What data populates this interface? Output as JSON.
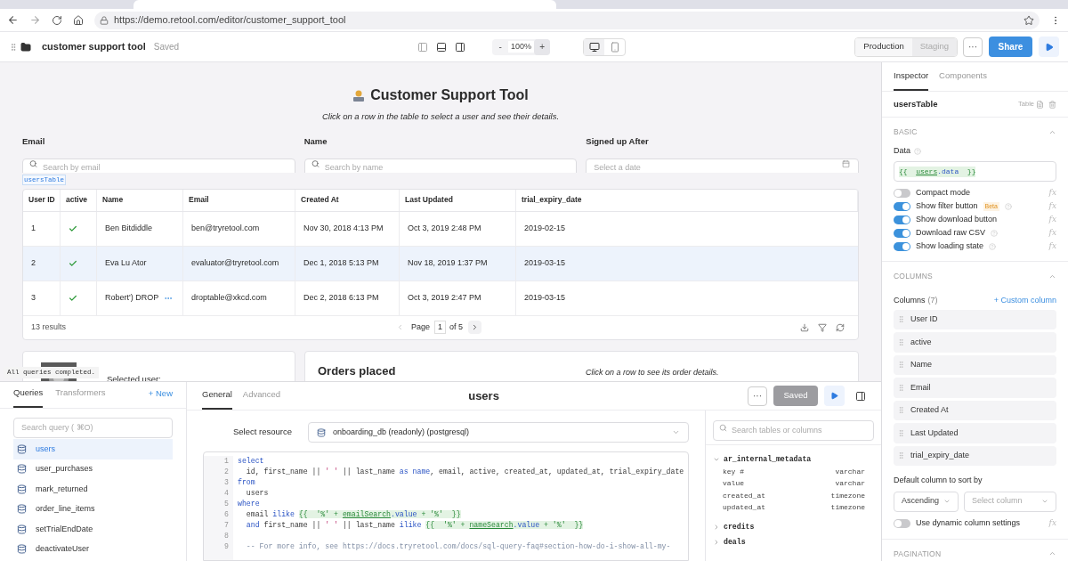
{
  "browser": {
    "url": "https://demo.retool.com/editor/customer_support_tool"
  },
  "app_header": {
    "title": "customer support tool",
    "status": "Saved",
    "zoom_out": "-",
    "zoom": "100%",
    "zoom_in": "+",
    "environments": [
      {
        "label": "Production",
        "selected": true
      },
      {
        "label": "Staging",
        "selected": false
      }
    ],
    "more": "···",
    "share": "Share"
  },
  "canvas": {
    "title": "Customer Support Tool",
    "subtitle": "Click on a row in the table to select a user and see their details.",
    "filters": [
      {
        "label": "Email",
        "placeholder": "Search by email",
        "kind": "search"
      },
      {
        "label": "Name",
        "placeholder": "Search by name",
        "kind": "search"
      },
      {
        "label": "Signed up After",
        "placeholder": "Select a date",
        "kind": "date"
      }
    ],
    "table_tag": "usersTable",
    "table": {
      "columns": [
        "User ID",
        "active",
        "Name",
        "Email",
        "Created At",
        "Last Updated",
        "trial_expiry_date"
      ],
      "rows": [
        {
          "user_id": "1",
          "active": true,
          "name": "Ben Bitdiddle",
          "name_overflow": false,
          "email": "ben@tryretool.com",
          "created_at": "Nov 30, 2018 4:13 PM",
          "last_updated": "Oct 3, 2019 2:48 PM",
          "trial_expiry_date": "2019-02-15",
          "selected": false
        },
        {
          "user_id": "2",
          "active": true,
          "name": "Eva Lu Ator",
          "name_overflow": false,
          "email": "evaluator@tryretool.com",
          "created_at": "Dec 1, 2018 5:13 PM",
          "last_updated": "Nov 18, 2019 1:37 PM",
          "trial_expiry_date": "2019-03-15",
          "selected": true
        },
        {
          "user_id": "3",
          "active": true,
          "name": "Robert') DROP",
          "name_overflow": true,
          "email": "droptable@xkcd.com",
          "created_at": "Dec 2, 2018 6:13 PM",
          "last_updated": "Oct 3, 2019 2:47 PM",
          "trial_expiry_date": "2019-03-15",
          "selected": false
        }
      ],
      "results": "13 results",
      "page_label": "Page",
      "page": "1",
      "page_of": "of 5"
    },
    "selected_user_card": {
      "label": "Selected user:"
    },
    "orders_card": {
      "title": "Orders placed",
      "hint": "Click on a row to see its order details."
    },
    "toast": "All queries completed."
  },
  "query_panel": {
    "tabs": [
      {
        "label": "Queries",
        "selected": true
      },
      {
        "label": "Transformers",
        "selected": false
      }
    ],
    "new": "+ New",
    "search_placeholder": "Search query ( ⌘O)",
    "queries": [
      {
        "name": "users",
        "selected": true
      },
      {
        "name": "user_purchases",
        "selected": false
      },
      {
        "name": "mark_returned",
        "selected": false
      },
      {
        "name": "order_line_items",
        "selected": false
      },
      {
        "name": "setTrialEndDate",
        "selected": false
      },
      {
        "name": "deactivateUser",
        "selected": false
      }
    ],
    "editor_tabs": [
      {
        "label": "General",
        "selected": true
      },
      {
        "label": "Advanced",
        "selected": false
      }
    ],
    "title": "users",
    "more": "···",
    "save": {
      "label": "Saved",
      "disabled": true
    },
    "resource_label": "Select resource",
    "resource": "onboarding_db (readonly) (postgresql)",
    "code": [
      {
        "number": "1",
        "segments": [
          {
            "kind": "keyword",
            "text": "select"
          }
        ]
      },
      {
        "number": "2",
        "segments": [
          {
            "kind": "plain",
            "text": "  id, first_name || "
          },
          {
            "kind": "string",
            "text": "' '"
          },
          {
            "kind": "plain",
            "text": " || last_name "
          },
          {
            "kind": "keyword",
            "text": "as "
          },
          {
            "kind": "keyword",
            "text": "name"
          },
          {
            "kind": "plain",
            "text": ", email, active, created_at, updated_at, trial_expiry_date"
          }
        ]
      },
      {
        "number": "3",
        "segments": [
          {
            "kind": "keyword",
            "text": "from"
          }
        ]
      },
      {
        "number": "4",
        "segments": [
          {
            "kind": "plain",
            "text": "  users"
          }
        ]
      },
      {
        "number": "5",
        "segments": [
          {
            "kind": "keyword",
            "text": "where"
          }
        ]
      },
      {
        "number": "6",
        "segments": [
          {
            "kind": "plain",
            "text": "  email "
          },
          {
            "kind": "keyword",
            "text": "ilike "
          },
          {
            "kind": "expr",
            "text": "{{  '%' + "
          },
          {
            "kind": "ref",
            "text": "emailSearch"
          },
          {
            "kind": "member",
            "text": ".value"
          },
          {
            "kind": "expr",
            "text": " + '%'  }}"
          }
        ]
      },
      {
        "number": "7",
        "segments": [
          {
            "kind": "keyword",
            "text": "  and"
          },
          {
            "kind": "plain",
            "text": " first_name || "
          },
          {
            "kind": "string",
            "text": "' '"
          },
          {
            "kind": "plain",
            "text": " || last_name "
          },
          {
            "kind": "keyword",
            "text": "ilike "
          },
          {
            "kind": "expr",
            "text": "{{  '%' + "
          },
          {
            "kind": "ref",
            "text": "nameSearch"
          },
          {
            "kind": "member",
            "text": ".value"
          },
          {
            "kind": "expr",
            "text": " + '%'  }}"
          }
        ]
      },
      {
        "number": "8"
      },
      {
        "number": "9",
        "segments": [
          {
            "kind": "comment",
            "text": "  -- For more info, see https://docs.tryretool.com/docs/sql-query-faq#section-how-do-i-show-all-my-"
          }
        ]
      }
    ],
    "schema_search_placeholder": "Search tables or columns",
    "schema": [
      {
        "name": "ar_internal_metadata",
        "expanded": true,
        "columns": [
          {
            "name": "key #",
            "type": "varchar"
          },
          {
            "name": "value",
            "type": "varchar"
          },
          {
            "name": "created_at",
            "type": "timezone"
          },
          {
            "name": "updated_at",
            "type": "timezone"
          }
        ]
      },
      {
        "name": "credits",
        "expanded": false
      },
      {
        "name": "deals",
        "expanded": false
      }
    ]
  },
  "inspector": {
    "tabs": [
      {
        "label": "Inspector",
        "selected": true
      },
      {
        "label": "Components",
        "selected": false
      }
    ],
    "component": "usersTable",
    "component_type": "Table",
    "basic": {
      "title": "BASIC",
      "data_label": "Data",
      "data_value": [
        {
          "kind": "expr",
          "text": "{{  "
        },
        {
          "kind": "ref",
          "text": "users"
        },
        {
          "kind": "member",
          "text": ".data"
        },
        {
          "kind": "expr",
          "text": "  }}"
        }
      ],
      "toggles": [
        {
          "label": "Compact mode",
          "on": false,
          "help": false,
          "formula": "fx"
        },
        {
          "label": "Show filter button",
          "on": true,
          "badge": "Beta",
          "help": true,
          "formula": "fx"
        },
        {
          "label": "Show download button",
          "on": true,
          "help": false,
          "formula": "fx"
        },
        {
          "label": "Download raw CSV",
          "on": true,
          "help": true,
          "formula": "fx"
        },
        {
          "label": "Show loading state",
          "on": true,
          "help": true,
          "formula": "fx"
        }
      ]
    },
    "columns": {
      "title": "COLUMNS",
      "label": "Columns",
      "count": "(7)",
      "add": "+ Custom column",
      "items": [
        "User ID",
        "active",
        "Name",
        "Email",
        "Created At",
        "Last Updated",
        "trial_expiry_date"
      ],
      "sort_label": "Default column to sort by",
      "sort_order": "Ascending",
      "sort_column_placeholder": "Select column",
      "dynamic": {
        "label": "Use dynamic column settings",
        "on": false,
        "formula": "fx"
      }
    },
    "pagination": {
      "title": "PAGINATION"
    }
  }
}
